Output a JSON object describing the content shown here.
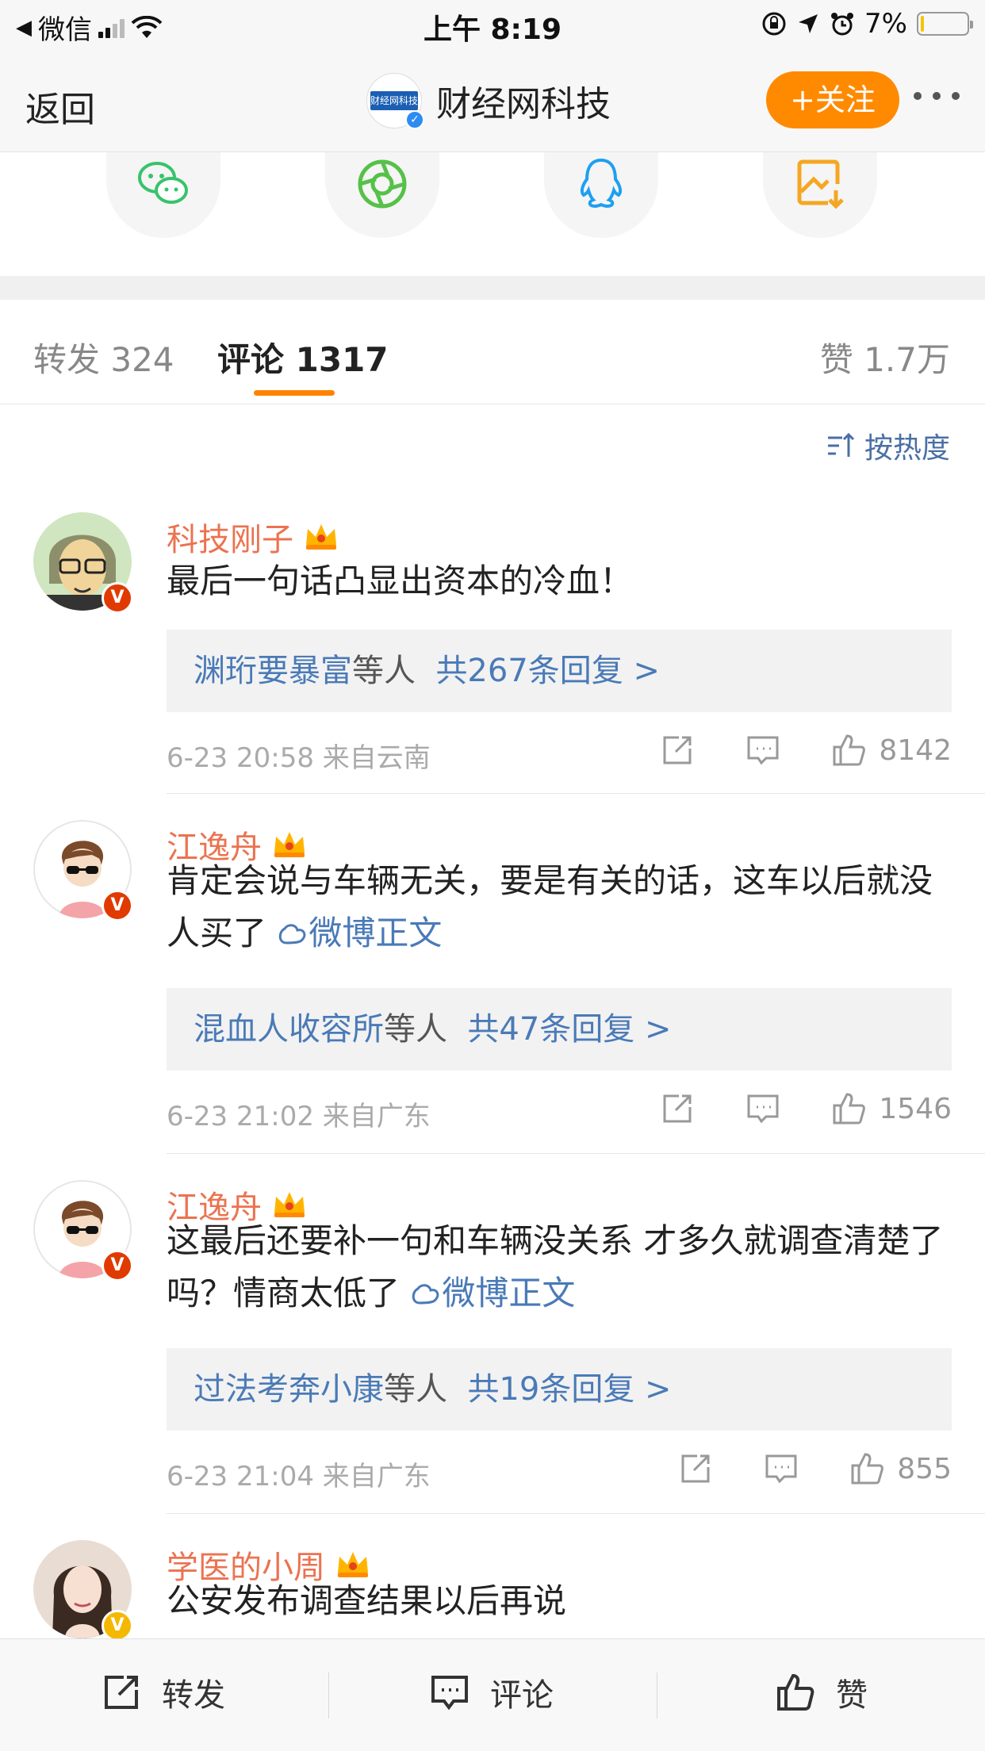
{
  "status_bar": {
    "back_app": "微信",
    "time": "上午 8:19",
    "battery": "7%",
    "battery_level": 0.07
  },
  "nav": {
    "back": "返回",
    "account_name": "财经网科技",
    "logo_text": "财经网科技",
    "follow": "+关注"
  },
  "share_icons": [
    "wechat-icon",
    "moments-icon",
    "qq-icon",
    "save-image-icon"
  ],
  "tabs": {
    "repost": "转发 324",
    "comments": "评论 1317",
    "likes": "赞 1.7万"
  },
  "sort_label": "按热度",
  "comments": [
    {
      "user": "科技刚子",
      "text": "最后一句话凸显出资本的冷血！",
      "weibo_link": "",
      "reply_user": "渊珩要暴富",
      "reply_mid": "等人",
      "reply_count": "共267条回复 >",
      "meta": "6-23 20:58  来自云南",
      "likes": "8142"
    },
    {
      "user": "江逸舟",
      "text": "肯定会说与车辆无关，要是有关的话，这车以后就没人买了",
      "weibo_link": "微博正文",
      "reply_user": "混血人收容所",
      "reply_mid": "等人",
      "reply_count": "共47条回复 >",
      "meta": "6-23 21:02  来自广东",
      "likes": "1546"
    },
    {
      "user": "江逸舟",
      "text": "这最后还要补一句和车辆没关系 才多久就调查清楚了吗？情商太低了",
      "weibo_link": "微博正文",
      "reply_user": "过法考奔小康",
      "reply_mid": "等人",
      "reply_count": "共19条回复 >",
      "meta": "6-23 21:04  来自广东",
      "likes": "855"
    },
    {
      "user": "学医的小周",
      "text": "公安发布调查结果以后再说"
    }
  ],
  "bottom_bar": {
    "repost": "转发",
    "comment": "评论",
    "like": "赞"
  },
  "colors": {
    "accent": "#ff8200",
    "username": "#eb7350",
    "link": "#4a7ab7"
  }
}
